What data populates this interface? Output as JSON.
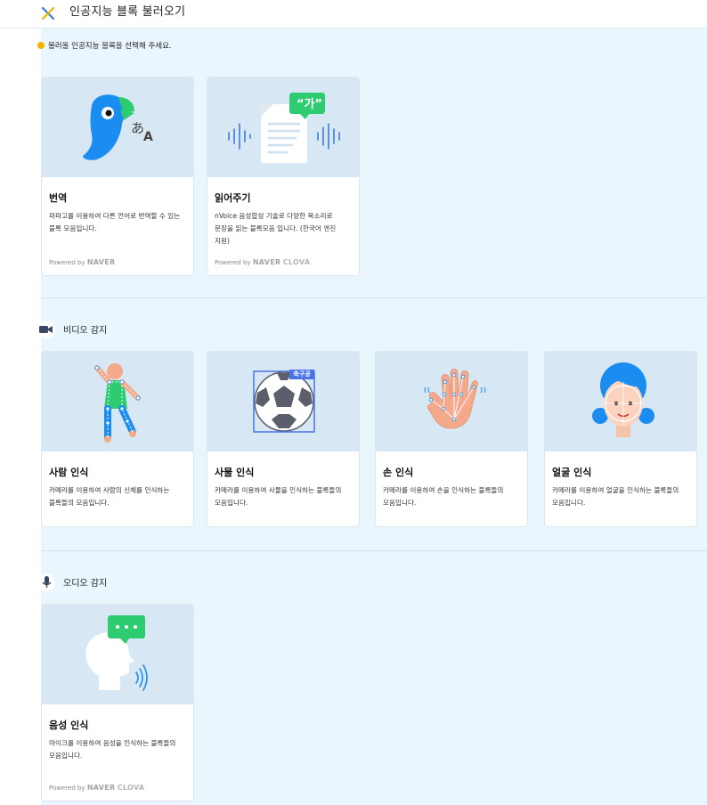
{
  "header": {
    "title": "인공지능 블록 불러오기"
  },
  "notice": "불러올 인공지능 블록을 선택해 주세요.",
  "powered": {
    "prefix": "Powered by",
    "naver": "NAVER",
    "clova": "CLOVA"
  },
  "sections": [
    {
      "label": "",
      "cards": [
        {
          "title": "번역",
          "desc": "파파고를 이용하여 다른 언어로 번역할 수 있는 블록 모음입니다.",
          "powered": "NAVER"
        },
        {
          "title": "읽어주기",
          "desc": "nVoice 음성합성 기술로 다양한 목소리로 문장을 읽는 블록모음 입니다. (한국어 엔진 지원)",
          "powered": "NAVER CLOVA"
        }
      ]
    },
    {
      "label": "비디오 감지",
      "cards": [
        {
          "title": "사람 인식",
          "desc": "카메라를 이용하여 사람의 신체를 인식하는 블록들의 모음입니다."
        },
        {
          "title": "사물 인식",
          "desc": "카메라를 이용하여 사물을 인식하는 블록들의 모음입니다.",
          "badge": "축구공"
        },
        {
          "title": "손 인식",
          "desc": "카메라를 이용하여 손을 인식하는 블록들의 모음입니다."
        },
        {
          "title": "얼굴 인식",
          "desc": "카메라를 이용하여 얼굴을 인식하는 블록들의 모음입니다."
        }
      ]
    },
    {
      "label": "오디오 감지",
      "cards": [
        {
          "title": "음성 인식",
          "desc": "마이크를 이용하여 음성을 인식하는 블록들의 모음입니다.",
          "powered": "NAVER CLOVA"
        }
      ]
    }
  ],
  "colors": {
    "background": "#eaf6fd",
    "card_image_bg": "#d7e8f4",
    "accent_blue": "#1b8cf0",
    "accent_green": "#2ecc71",
    "close_yellow": "#f4b400"
  }
}
